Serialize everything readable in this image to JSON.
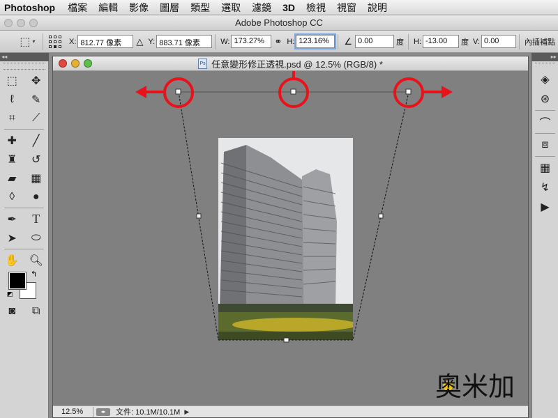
{
  "menu": {
    "app_name": "Photoshop",
    "items": [
      "檔案",
      "編輯",
      "影像",
      "圖層",
      "類型",
      "選取",
      "濾鏡",
      "3D",
      "檢視",
      "視窗",
      "說明"
    ]
  },
  "window_title": "Adobe Photoshop CC",
  "options_bar": {
    "x_label": "X:",
    "x_value": "812.77 像素",
    "y_label": "Y:",
    "y_value": "883.71 像素",
    "w_label": "W:",
    "w_value": "173.27%",
    "h_label": "H:",
    "h_value": "123.16%",
    "angle_value": "0.00",
    "angle_unit": "度",
    "hskew_label": "H:",
    "hskew_value": "-13.00",
    "hskew_unit": "度",
    "vskew_label": "V:",
    "vskew_value": "0.00",
    "interpolation": "內插補點"
  },
  "document": {
    "title": "任意變形修正透視.psd @ 12.5% (RGB/8) *",
    "zoom": "12.5%",
    "doc_size": "文件: 10.1M/10.1M"
  },
  "watermark_text": "奧米加",
  "colors": {
    "arrow_red": "#e8131a",
    "foreground": "#000000",
    "background": "#ffffff",
    "canvas": "#808080"
  },
  "icons": {
    "tools": [
      "rect-marquee-icon",
      "move-icon",
      "lasso-icon",
      "quick-select-icon",
      "crop-icon",
      "eyedropper-icon",
      "healing-brush-icon",
      "brush-icon",
      "clone-stamp-icon",
      "history-brush-icon",
      "eraser-icon",
      "gradient-icon",
      "blur-icon",
      "dodge-icon",
      "pen-icon",
      "type-icon",
      "path-select-icon",
      "ellipse-icon",
      "hand-icon",
      "zoom-icon"
    ],
    "right_panel": [
      "layers-icon",
      "channels-icon",
      "paths-icon",
      "3d-icon",
      "grid-icon",
      "history-icon",
      "play-icon"
    ]
  }
}
